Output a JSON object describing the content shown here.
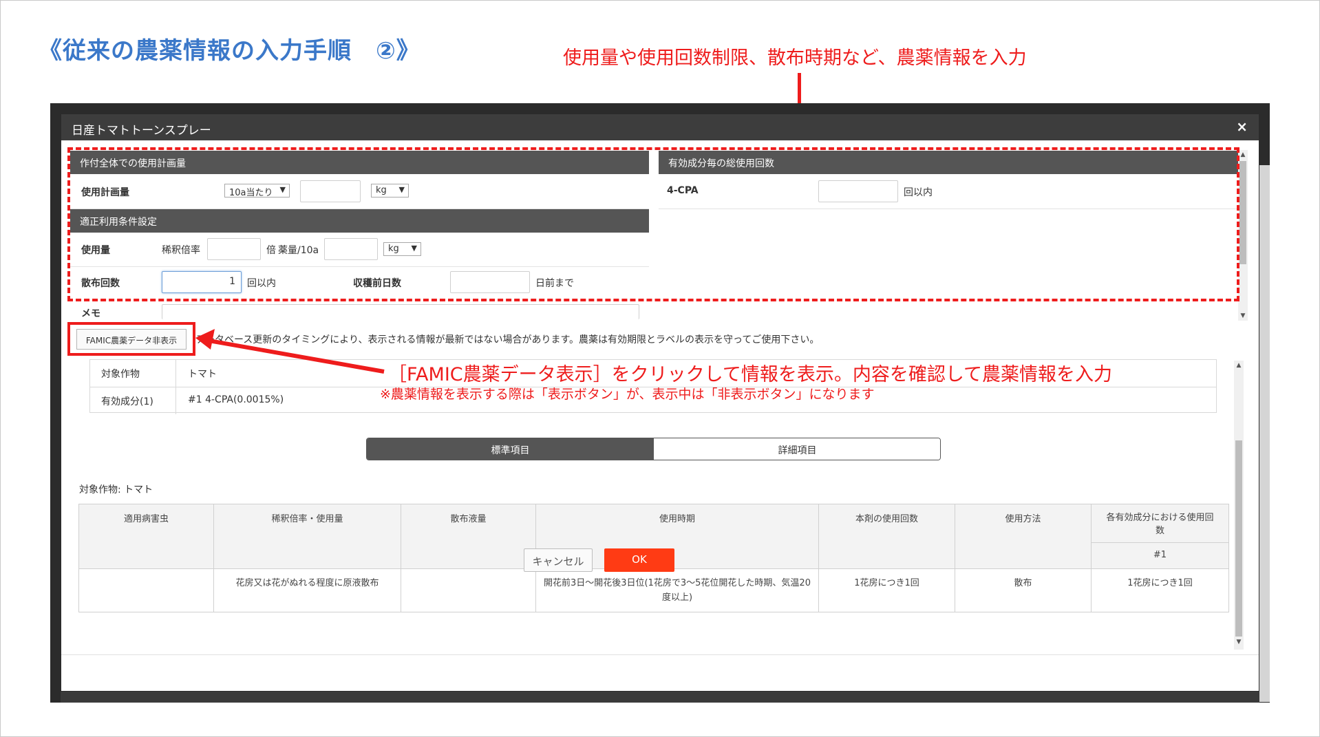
{
  "slide": {
    "title": "《従来の農薬情報の入力手順　②》",
    "annotation_top": "使用量や使用回数制限、散布時期など、農薬情報を入力",
    "annotation_middle": "［FAMIC農薬データ表示］をクリックして情報を表示。内容を確認して農薬情報を入力",
    "annotation_note": "※農薬情報を表示する際は「表示ボタン」が、表示中は「非表示ボタン」になります",
    "accent_color": "#ee1c1c",
    "title_color": "#3b78c9"
  },
  "modal": {
    "title": "日産トマトトーンスプレー",
    "close_icon": "×",
    "plan_section": {
      "header": "作付全体での使用計画量",
      "row_label": "使用計画量",
      "unit_select": "10a当たり",
      "amount_value": "",
      "mass_select": "kg"
    },
    "ingredient_section": {
      "header": "有効成分毎の総使用回数",
      "ingredient_name": "4-CPA",
      "count_value": "",
      "suffix": "回以内"
    },
    "conditions_section": {
      "header": "適正利用条件設定",
      "usage_label": "使用量",
      "dilution_label": "稀釈倍率",
      "dilution_value": "",
      "dilution_suffix": "倍",
      "dose_label": "薬量/10a",
      "dose_value": "",
      "dose_unit_select": "kg",
      "spray_label": "散布回数",
      "spray_value": "1",
      "spray_suffix": "回以内",
      "preharvest_label": "収穫前日数",
      "preharvest_value": "",
      "preharvest_suffix": "日前まで"
    },
    "memo_label": "メモ",
    "famic_button": "FAMIC農薬データ非表示",
    "notice": "データベース更新のタイミングにより、表示される情報が最新ではない場合があります。農薬は有効期限とラベルの表示を守ってご使用下さい。",
    "info": {
      "crop_key": "対象作物",
      "crop_value": "トマト",
      "ingredient_key": "有効成分(1)",
      "ingredient_value": "#1 4-CPA(0.0015%)"
    },
    "tabs": [
      {
        "label": "標準項目",
        "active": true
      },
      {
        "label": "詳細項目",
        "active": false
      }
    ],
    "crop_label": "対象作物: トマト",
    "table": {
      "headers": [
        "適用病害虫",
        "稀釈倍率・使用量",
        "散布液量",
        "使用時期",
        "本剤の使用回数",
        "使用方法",
        "各有効成分における使用回数"
      ],
      "subheader": "#1",
      "rows": [
        [
          "",
          "花房又は花がぬれる程度に原液散布",
          "",
          "開花前3日～開花後3日位(1花房で3～5花位開花した時期、気温20度以上)",
          "1花房につき1回",
          "散布",
          "1花房につき1回"
        ]
      ]
    },
    "cancel_button": "キャンセル",
    "ok_button": "OK",
    "ok_color": "#ff3b14"
  }
}
